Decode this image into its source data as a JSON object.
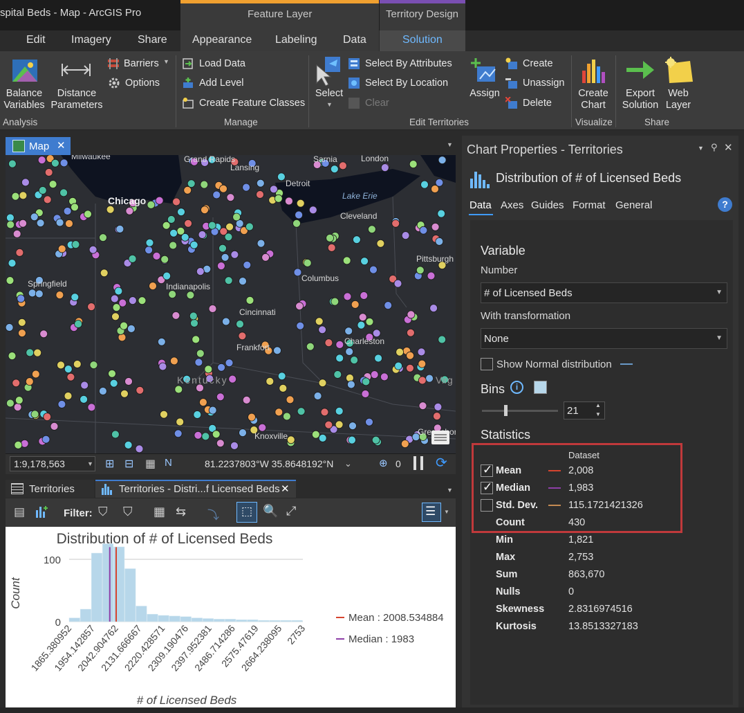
{
  "window": {
    "title": "spital Beds - Map - ArcGIS Pro",
    "context_tabs": {
      "feature_layer": "Feature Layer",
      "territory_design": "Territory Design"
    },
    "tabs": [
      "Edit",
      "Imagery",
      "Share",
      "Appearance",
      "Labeling",
      "Data",
      "Solution"
    ],
    "active_tab": "Solution"
  },
  "ribbon": {
    "analysis": {
      "group_label": "Analysis",
      "balance": "Balance\nVariables",
      "distance": "Distance\nParameters",
      "barriers": "Barriers",
      "options": "Options"
    },
    "manage": {
      "group_label": "Manage",
      "load_data": "Load Data",
      "add_level": "Add Level",
      "create_feature_classes": "Create Feature Classes"
    },
    "edit_territories": {
      "group_label": "Edit Territories",
      "select": "Select",
      "select_by_attributes": "Select By Attributes",
      "select_by_location": "Select By Location",
      "clear": "Clear",
      "assign": "Assign",
      "create": "Create",
      "unassign": "Unassign",
      "delete": "Delete"
    },
    "visualize": {
      "group_label": "Visualize",
      "create_chart": "Create\nChart"
    },
    "share": {
      "group_label": "Share",
      "export_solution": "Export\nSolution",
      "web_layer": "Web\nLayer"
    }
  },
  "map": {
    "tab_label": "Map",
    "places": [
      "Milwaukee",
      "Grand Rapids",
      "Lansing",
      "Sarnia",
      "London",
      "Chicago",
      "Detroit",
      "Lake Erie",
      "Cleveland",
      "Pittsburgh",
      "Springfield",
      "Indianapolis",
      "Columbus",
      "Cincinnati",
      "Charleston",
      "Frankfort",
      "Kentucky",
      "Knoxville",
      "Virg",
      "Greensboro"
    ],
    "scale": "1:9,178,563",
    "coordinates": "81.2237803°W 35.8648192°N",
    "selected_count": "0"
  },
  "bottom_tabs": {
    "tab1": "Territories",
    "tab2": "Territories - Distri...f Licensed Beds"
  },
  "chart_toolbar": {
    "filter_label": "Filter:"
  },
  "chart_data": {
    "type": "bar",
    "title": "Distribution of # of Licensed Beds",
    "xlabel": "# of Licensed Beds",
    "ylabel": "Count",
    "x_tick_labels": [
      "1865.380952",
      "1954.142857",
      "2042.904762",
      "2131.666667",
      "2220.428571",
      "2309.190476",
      "2397.952381",
      "2486.714286",
      "2575.47619",
      "2664.238095",
      "2753"
    ],
    "y_ticks": [
      0,
      100
    ],
    "ylim": [
      0,
      130
    ],
    "xlim": [
      1821,
      2753
    ],
    "bins": 21,
    "counts": [
      6,
      20,
      110,
      125,
      120,
      85,
      25,
      12,
      10,
      9,
      8,
      6,
      5,
      4,
      4,
      3,
      3,
      2,
      2,
      2,
      2
    ],
    "reference_lines": [
      {
        "name": "Mean : 2008.534884",
        "value": 2008.534884,
        "color": "#d6442f"
      },
      {
        "name": "Median : 1983",
        "value": 1983,
        "color": "#8e3fa8"
      }
    ],
    "legend": "right",
    "bar_color": "#b7d7ea"
  },
  "chart_properties": {
    "pane_title": "Chart Properties - Territories",
    "heading": "Distribution of # of Licensed Beds",
    "tabs": [
      "Data",
      "Axes",
      "Guides",
      "Format",
      "General"
    ],
    "variable": {
      "section": "Variable",
      "number_label": "Number",
      "number_value": "# of Licensed Beds",
      "transform_label": "With transformation",
      "transform_value": "None",
      "show_normal": "Show Normal distribution"
    },
    "bins": {
      "label": "Bins",
      "value": "21"
    },
    "statistics": {
      "section": "Statistics",
      "column": "Dataset",
      "rows": [
        {
          "name": "Mean",
          "value": "2,008",
          "checked": true,
          "line_color": "#d6442f"
        },
        {
          "name": "Median",
          "value": "1,983",
          "checked": true,
          "line_color": "#8e3fa8"
        },
        {
          "name": "Std. Dev.",
          "value": "115.1721421326",
          "checked": false,
          "line_color": "#c48a52"
        },
        {
          "name": "Count",
          "value": "430"
        },
        {
          "name": "Min",
          "value": "1,821"
        },
        {
          "name": "Max",
          "value": "2,753"
        },
        {
          "name": "Sum",
          "value": "863,670"
        },
        {
          "name": "Nulls",
          "value": "0"
        },
        {
          "name": "Skewness",
          "value": "2.8316974516"
        },
        {
          "name": "Kurtosis",
          "value": "13.8513327183"
        }
      ]
    }
  }
}
